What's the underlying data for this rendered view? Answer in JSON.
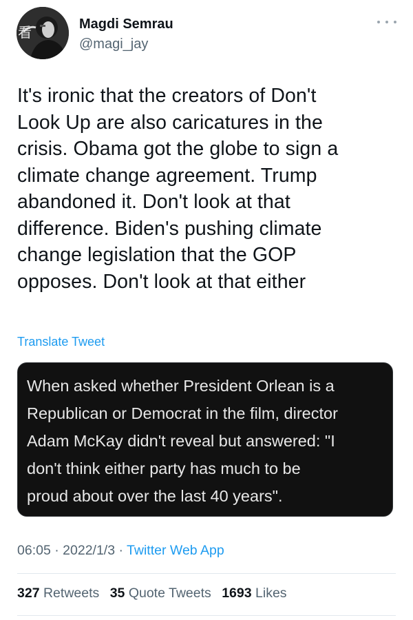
{
  "author": {
    "name": "Magdi Semrau",
    "handle": "@magi_jay",
    "avatar_icon": "profile-photo",
    "avatar_watermark": "看"
  },
  "menu_icon": "more-horizontal-icon",
  "tweet": {
    "lines": [
      "It's ironic that the creators of Don't",
      "Look Up are also caricatures in the",
      "crisis. Obama got the globe to sign a",
      "climate change agreement. Trump",
      "abandoned it. Don't look at that",
      "difference. Biden's pushing climate",
      "change legislation that the GOP",
      "opposes. Don't look at that either"
    ]
  },
  "translate_label": "Translate Tweet",
  "media": {
    "lines": [
      "When asked whether President Orlean is a",
      "Republican or Democrat in the film, director",
      "Adam McKay didn't reveal but answered: \"I",
      "don't think either party has much to be",
      "proud about over the last 40 years\"."
    ],
    "background": "#111111",
    "text_color": "#e7e7e7"
  },
  "meta": {
    "time": "06:05",
    "separator1": " · ",
    "date": "2022/1/3",
    "separator2": " · ",
    "app": "Twitter Web App"
  },
  "stats": {
    "retweets_count": "327",
    "retweets_label": "Retweets",
    "quotes_count": "35",
    "quotes_label": "Quote Tweets",
    "likes_count": "1693",
    "likes_label": "Likes"
  },
  "colors": {
    "link": "#1d9bf0",
    "secondary": "#536471",
    "primary": "#0f1419"
  }
}
